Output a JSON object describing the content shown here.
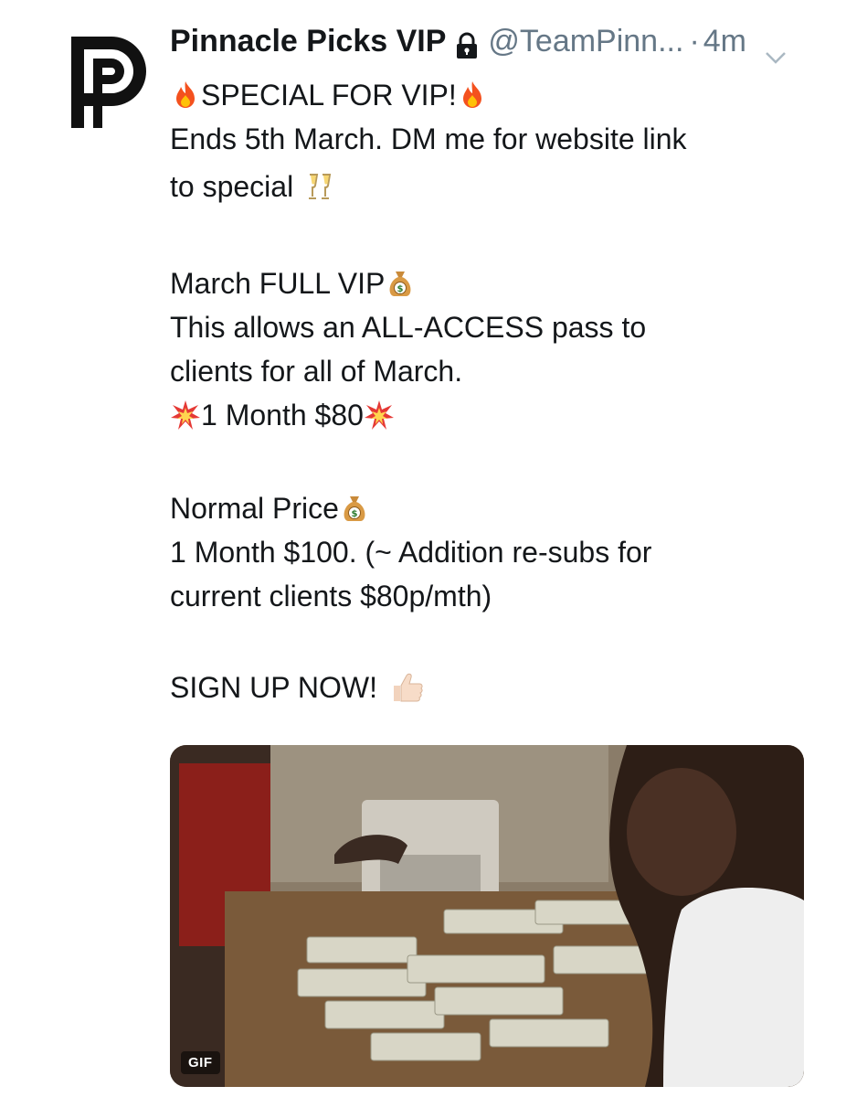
{
  "tweet": {
    "display_name": "Pinnacle Picks VIP",
    "handle": "@TeamPinn...",
    "separator": "·",
    "timestamp": "4m",
    "lines": {
      "l1": "SPECIAL FOR VIP!",
      "l2": "Ends 5th March. DM me for website link",
      "l3": "to special",
      "l4": "March FULL VIP",
      "l5": "This allows an ALL-ACCESS pass to",
      "l6": "clients for all of March.",
      "l7": "1 Month $80",
      "l8": "Normal Price",
      "l9": "1 Month $100. (~ Addition re-subs for",
      "l10": "current clients $80p/mth)",
      "l11": "SIGN UP NOW!"
    },
    "media": {
      "badge": "GIF"
    }
  },
  "icons": {
    "avatar": "pinnacle-logo",
    "lock": "lock-icon",
    "chevron": "chevron-down-icon",
    "fire": "fire-emoji",
    "glasses": "clinking-glasses-emoji",
    "money_bag": "money-bag-emoji",
    "collision": "collision-emoji",
    "thumbs_up": "thumbs-up-emoji"
  },
  "colors": {
    "text": "#14171a",
    "secondary": "#657786"
  }
}
